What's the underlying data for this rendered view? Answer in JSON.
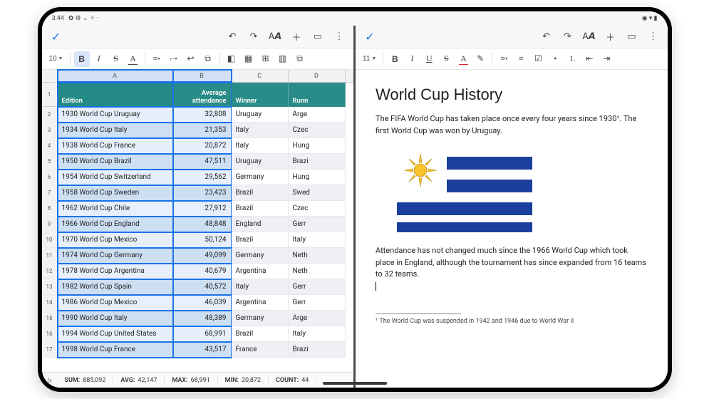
{
  "statusbar": {
    "time": "3:44",
    "left_icons": "✿ ⚙ ⌄ ✧ ·",
    "right_icons": "◉ ▾ ▮"
  },
  "sheets": {
    "font_size": "10",
    "toolbar": {
      "undo": "↶",
      "redo": "↷",
      "font": "A𝘼",
      "add": "＋",
      "comment": "▭",
      "more": "⋮",
      "bold": "B",
      "italic": "I",
      "strike": "S",
      "textcolor": "A",
      "halign": "≡",
      "valign": "⌐",
      "wrap": "↩",
      "merge": "⧉",
      "fill": "◧",
      "borders": "▦",
      "insert": "⊞",
      "freeze": "▥",
      "link": "⧉"
    },
    "columns": [
      "A",
      "B",
      "C",
      "D"
    ],
    "headers": {
      "A": "Edition",
      "B1": "Average",
      "B2": "attendance",
      "C": "Winner",
      "D": "Runn"
    },
    "rows": [
      {
        "n": "2",
        "a": "1930 World Cup Uruguay",
        "b": "32,808",
        "c": "Uruguay",
        "d": "Arge"
      },
      {
        "n": "3",
        "a": "1934 World Cup Italy",
        "b": "21,353",
        "c": "Italy",
        "d": "Czec"
      },
      {
        "n": "4",
        "a": "1938 World Cup France",
        "b": "20,872",
        "c": "Italy",
        "d": "Hung"
      },
      {
        "n": "5",
        "a": "1950 World Cup Brazil",
        "b": "47,511",
        "c": "Uruguay",
        "d": "Brazi"
      },
      {
        "n": "6",
        "a": "1954 World Cup Switzerland",
        "b": "29,562",
        "c": "Germany",
        "d": "Hung"
      },
      {
        "n": "7",
        "a": "1958 World Cup Sweden",
        "b": "23,423",
        "c": "Brazil",
        "d": "Swed"
      },
      {
        "n": "8",
        "a": "1962 World Cup Chile",
        "b": "27,912",
        "c": "Brazil",
        "d": "Czec"
      },
      {
        "n": "9",
        "a": "1966 World Cup England",
        "b": "48,848",
        "c": "England",
        "d": "Gerr"
      },
      {
        "n": "10",
        "a": "1970 World Cup Mexico",
        "b": "50,124",
        "c": "Brazil",
        "d": "Italy"
      },
      {
        "n": "11",
        "a": "1974 World Cup Germany",
        "b": "49,099",
        "c": "Germany",
        "d": "Neth"
      },
      {
        "n": "12",
        "a": "1978 World Cup Argentina",
        "b": "40,679",
        "c": "Argentina",
        "d": "Neth"
      },
      {
        "n": "13",
        "a": "1982 World Cup Spain",
        "b": "40,572",
        "c": "Italy",
        "d": "Gerr"
      },
      {
        "n": "14",
        "a": "1986 World Cup Mexico",
        "b": "46,039",
        "c": "Argentina",
        "d": "Gerr"
      },
      {
        "n": "15",
        "a": "1990 World Cup Italy",
        "b": "48,389",
        "c": "Germany",
        "d": "Arge"
      },
      {
        "n": "16",
        "a": "1994 World Cup United States",
        "b": "68,991",
        "c": "Brazil",
        "d": "Italy"
      },
      {
        "n": "17",
        "a": "1998 World Cup France",
        "b": "43,517",
        "c": "France",
        "d": "Brazi"
      }
    ],
    "stats": {
      "sum_l": "SUM:",
      "sum_v": "885,092",
      "avg_l": "AVG:",
      "avg_v": "42,147",
      "max_l": "MAX:",
      "max_v": "68,991",
      "min_l": "MIN:",
      "min_v": "20,872",
      "cnt_l": "COUNT:",
      "cnt_v": "44"
    }
  },
  "docs": {
    "font_size": "11",
    "toolbar": {
      "undo": "↶",
      "redo": "↷",
      "font": "A𝘼",
      "add": "＋",
      "comment": "▭",
      "more": "⋮",
      "bold": "B",
      "italic": "I",
      "under": "U",
      "strike": "S",
      "textcolor": "A",
      "highlight": "✎",
      "align": "≡",
      "lineh": "≡",
      "check": "☑",
      "bullets": "•",
      "numbers": "1.",
      "ind_dec": "⇤",
      "ind_inc": "⇥"
    },
    "title": "World Cup History",
    "p1": "The FIFA World Cup has taken place once every four years since 1930¹. The first World Cup was won by Uruguay.",
    "p2": "Attendance has not changed much since the 1966 World Cup which took place in England, although the tournament has since expanded from 16 teams to 32 teams.",
    "footnote": "¹ The World Cup was suspended in 1942 and 1946 due to World War II"
  }
}
